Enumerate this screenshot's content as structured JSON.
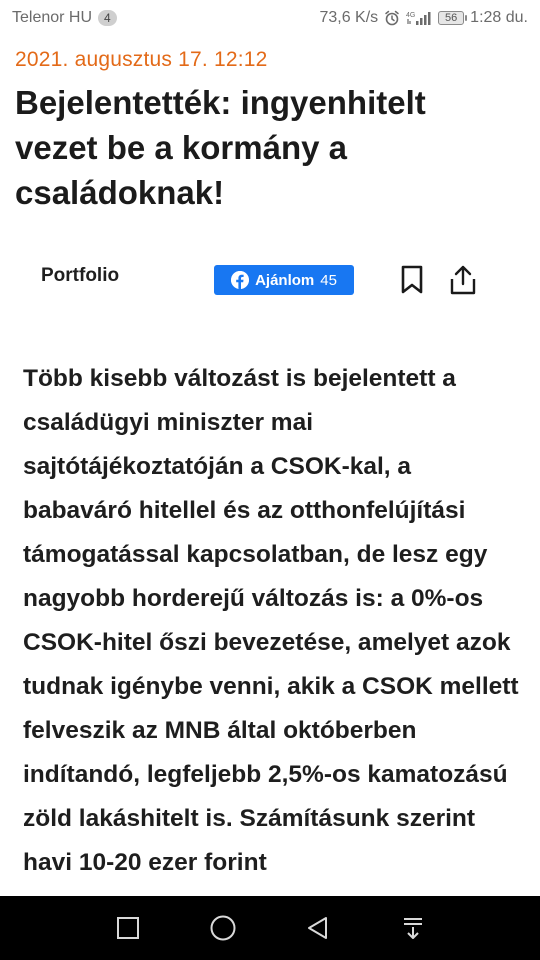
{
  "status_bar": {
    "carrier": "Telenor HU",
    "notification_count": "4",
    "speed": "73,6 K/s",
    "network": "4G",
    "battery": "56",
    "time": "1:28 du."
  },
  "article": {
    "date": "2021. augusztus 17. 12:12",
    "headline": "Bejelentették: ingyenhitelt vezet be a kormány a családoknak!",
    "source": "Portfolio",
    "like_button": {
      "label": "Ajánlom",
      "count": "45"
    },
    "lead": "Több kisebb változást is bejelentett a családügyi miniszter mai sajtótájékoztatóján a CSOK-kal, a babaváró hitellel és az otthonfelújítási támogatással kapcsolatban, de lesz egy nagyobb horderejű változás is: a 0%-os CSOK-hitel őszi bevezetése, amelyet azok tudnak igénybe venni, akik a CSOK mellett felveszik az MNB által októberben indítandó, legfeljebb 2,5%-os kamatozású zöld lakáshitelt is. Számításunk szerint havi 10-20 ezer forint"
  },
  "colors": {
    "date_accent": "#e36a18",
    "facebook_blue": "#1877f2"
  },
  "icons": {
    "alarm": "alarm-icon",
    "signal": "signal-icon",
    "bookmark": "bookmark-icon",
    "share": "share-icon",
    "nav_recent": "square-icon",
    "nav_home": "circle-icon",
    "nav_back": "triangle-back-icon",
    "nav_notifications": "pull-down-icon"
  }
}
